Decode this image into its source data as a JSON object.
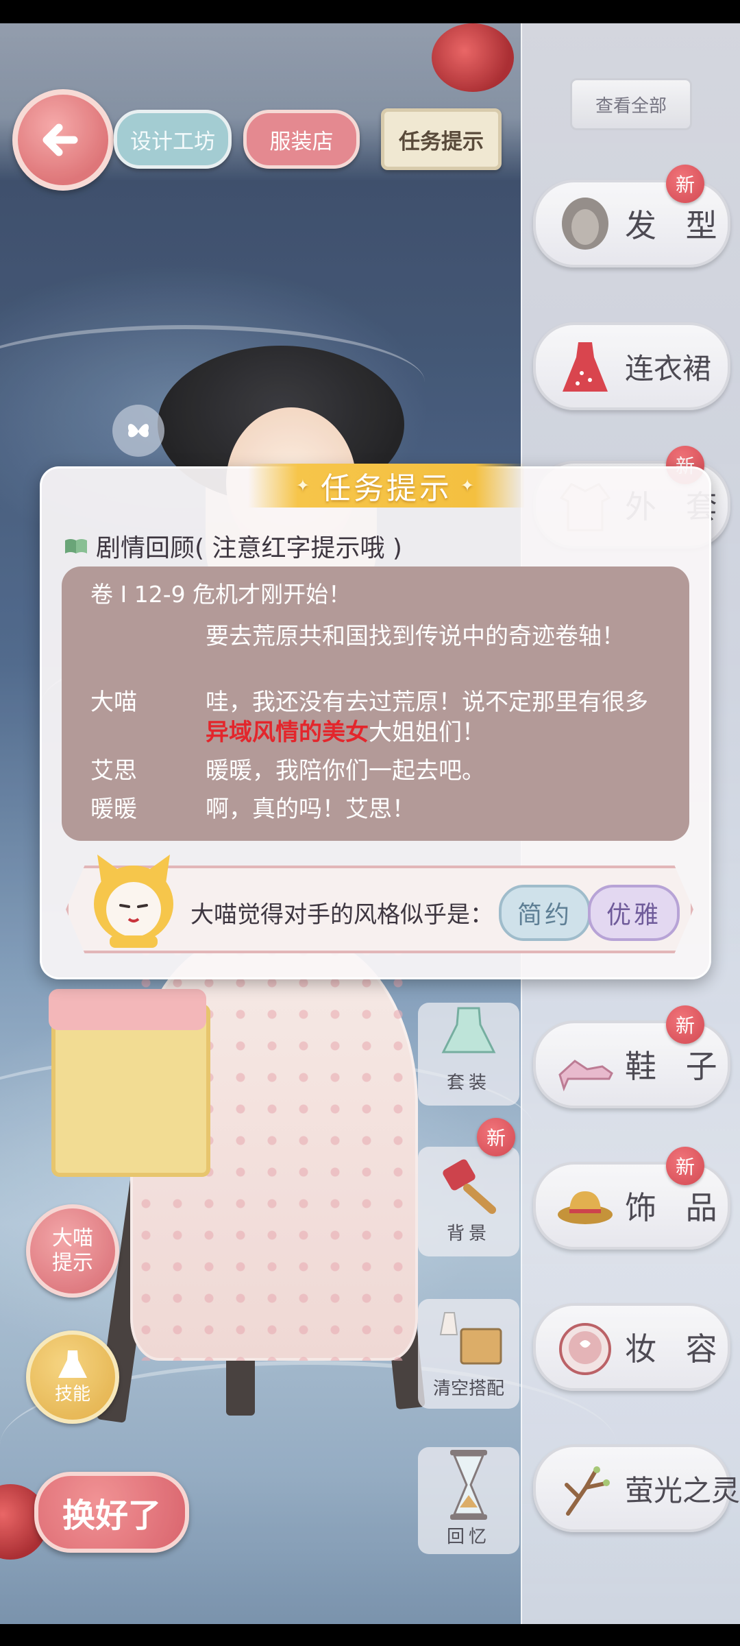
{
  "top_nav": {
    "design_label": "设计工坊",
    "shop_label": "服装店",
    "task_label": "任务提示"
  },
  "view_all_label": "查看全部",
  "categories": [
    {
      "label": "发 型",
      "icon": "hair-icon",
      "new": true
    },
    {
      "label": "连衣裙",
      "icon": "dress-icon",
      "new": false
    },
    {
      "label": "外 套",
      "icon": "coat-icon",
      "new": true
    },
    {
      "label": "鞋 子",
      "icon": "shoes-icon",
      "new": true
    },
    {
      "label": "饰 品",
      "icon": "hat-icon",
      "new": true
    },
    {
      "label": "妆 容",
      "icon": "makeup-icon",
      "new": false
    },
    {
      "label": "萤光之灵",
      "icon": "branch-icon",
      "new": false
    }
  ],
  "new_badge": "新",
  "tools": {
    "suit_label": "套装",
    "background_label": "背景",
    "clear_label": "清空搭配",
    "memory_label": "回忆"
  },
  "buttons": {
    "hint_label_1": "大喵",
    "hint_label_2": "提示",
    "skill_label": "技能",
    "done_label": "换好了"
  },
  "dialog": {
    "title": "任务提示",
    "recap_heading": "剧情回顾( 注意红字提示哦 )",
    "chapter": "卷 I 12-9 危机才刚开始！",
    "lines": [
      {
        "speaker": "",
        "text": "要去荒原共和国找到传说中的奇迹卷轴！"
      },
      {
        "speaker": "大喵",
        "text_before": "哇，我还没有去过荒原！说不定那里有很多",
        "highlight": "异域风情的美女",
        "text_after": "大姐姐们！"
      },
      {
        "speaker": "艾思",
        "text": "暖暖，我陪你们一起去吧。"
      },
      {
        "speaker": "暖暖",
        "text": "啊，真的吗！艾思！"
      }
    ],
    "opponent_prompt": "大喵觉得对手的风格似乎是：",
    "style_tags": [
      "简约",
      "优雅"
    ]
  },
  "colors": {
    "accent_gold": "#f6c54a",
    "highlight_red": "#e3262c",
    "badge_red": "#d94a52"
  }
}
